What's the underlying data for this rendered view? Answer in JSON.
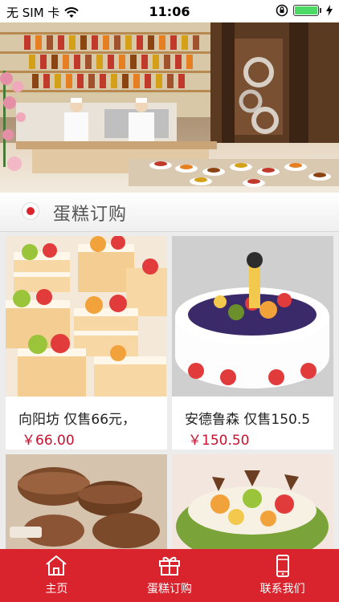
{
  "status_bar": {
    "carrier": "无 SIM 卡",
    "time": "11:06"
  },
  "section": {
    "title": "蛋糕订购"
  },
  "products": [
    {
      "name": "向阳坊 仅售66元，",
      "price": "￥66.00"
    },
    {
      "name": "安德鲁森 仅售150.5",
      "price": "￥150.50"
    },
    {
      "name": "",
      "price": ""
    },
    {
      "name": "",
      "price": ""
    }
  ],
  "tabbar": {
    "items": [
      {
        "label": "主页",
        "icon": "home-icon"
      },
      {
        "label": "蛋糕订购",
        "icon": "gift-icon"
      },
      {
        "label": "联系我们",
        "icon": "phone-icon"
      }
    ]
  },
  "colors": {
    "brand_red": "#d9232d",
    "price_red": "#c8102e"
  }
}
